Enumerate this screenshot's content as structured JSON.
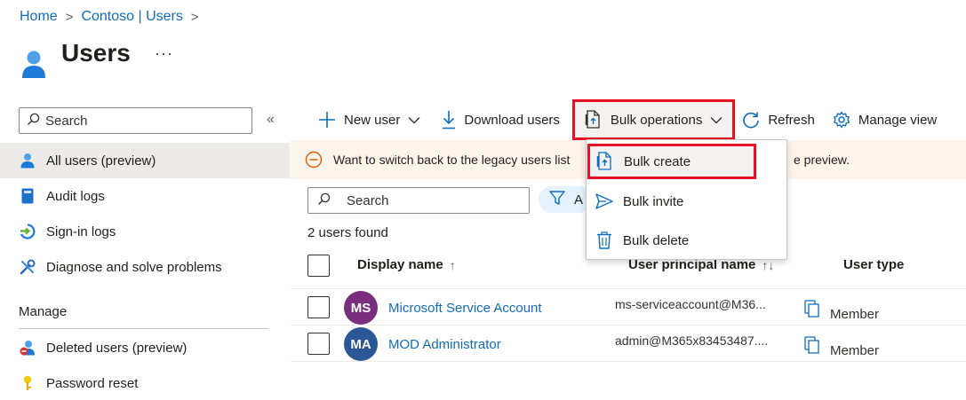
{
  "breadcrumb": [
    "Home",
    "Contoso | Users"
  ],
  "page": {
    "title": "Users",
    "more": "···"
  },
  "sidebar": {
    "search_placeholder": "Search",
    "collapse": "«",
    "items": [
      {
        "label": "All users (preview)",
        "icon": "user-icon",
        "active": true
      },
      {
        "label": "Audit logs",
        "icon": "book-icon"
      },
      {
        "label": "Sign-in logs",
        "icon": "sign-in-icon"
      },
      {
        "label": "Diagnose and solve problems",
        "icon": "wrench-icon"
      }
    ],
    "section_manage": "Manage",
    "manage_items": [
      {
        "label": "Deleted users (preview)",
        "icon": "deleted-user-icon"
      },
      {
        "label": "Password reset",
        "icon": "key-icon"
      }
    ]
  },
  "toolbar": {
    "new_user": "New user",
    "download_users": "Download users",
    "bulk_operations": "Bulk operations",
    "refresh": "Refresh",
    "manage_view": "Manage view"
  },
  "banner": {
    "text": "Want to switch back to the legacy users list",
    "tail": "e preview."
  },
  "main": {
    "search_placeholder": "Search",
    "filter_label": "A",
    "count": "2 users found"
  },
  "table": {
    "columns": {
      "display_name": "Display name",
      "display_name_sort": "↑",
      "upn": "User principal name",
      "upn_sort": "↑↓",
      "user_type": "User type"
    },
    "rows": [
      {
        "initials": "MS",
        "avatar_color": "#7a2f7e",
        "name": "Microsoft Service Account",
        "upn": "ms-serviceaccount@M36...",
        "type": "Member"
      },
      {
        "initials": "MA",
        "avatar_color": "#2b5797",
        "name": "MOD Administrator",
        "upn": "admin@M365x83453487....",
        "type": "Member"
      }
    ]
  },
  "dropdown": {
    "items": [
      "Bulk create",
      "Bulk invite",
      "Bulk delete"
    ]
  },
  "colors": {
    "accent": "#0f6cbd",
    "highlight": "#e81123",
    "banner_bg": "#fdf4ec"
  }
}
